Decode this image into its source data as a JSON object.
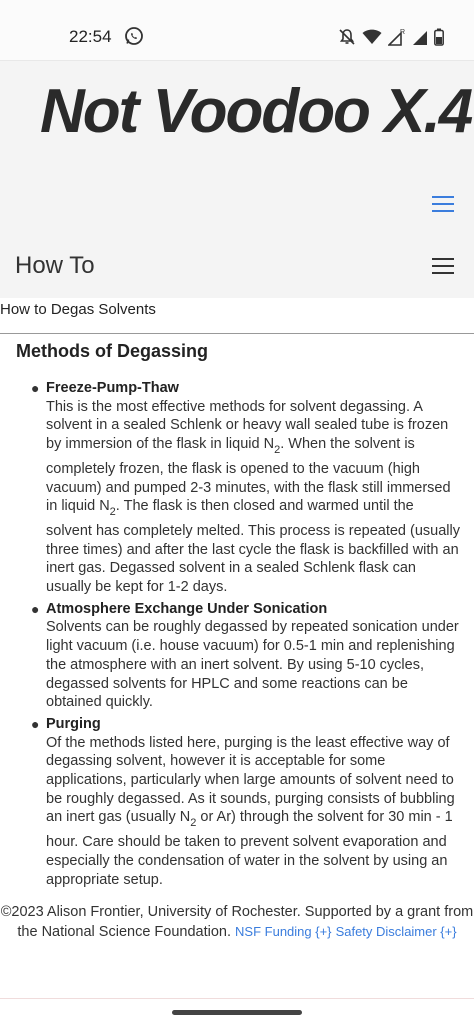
{
  "status_bar": {
    "time": "22:54",
    "icons": [
      "whatsapp-icon",
      "do-not-disturb-icon",
      "wifi-icon",
      "signal-r-icon",
      "signal-icon",
      "battery-icon"
    ],
    "roaming_mark": "R"
  },
  "header": {
    "logo": "Not Voodoo X.4",
    "section_title": "How To"
  },
  "breadcrumb": "How to Degas Solvents",
  "main": {
    "heading": "Methods of Degassing",
    "items": [
      {
        "title": "Freeze-Pump-Thaw",
        "text_1": "This is the most effective methods for solvent degassing. A solvent in a sealed Schlenk or heavy wall sealed tube is frozen by immersion of the flask in liquid N",
        "sub_1": "2",
        "text_2": ". When the solvent is completely frozen, the flask is opened to the vacuum (high vacuum) and pumped 2-3 minutes, with the flask still immersed in liquid N",
        "sub_2": "2",
        "text_3": ". The flask is then closed and warmed until the solvent has completely melted. This process is repeated (usually three times) and after the last cycle the flask is backfilled with an inert gas. Degassed solvent in a sealed Schlenk flask can usually be kept for 1-2 days."
      },
      {
        "title": "Atmosphere Exchange Under Sonication",
        "text_1": "Solvents can be roughly degassed by repeated sonication under light vacuum (i.e. house vacuum) for 0.5-1 min and replenishing the atmosphere with an inert solvent. By using 5-10 cycles, degassed solvents for HPLC and some reactions can be obtained quickly."
      },
      {
        "title": "Purging",
        "text_1": "Of the methods listed here, purging is the least effective way of degassing solvent, however it is acceptable for some applications, particularly when large amounts of solvent need to be roughly degassed. As it sounds, purging consists of bubbling an inert gas (usually N",
        "sub_1": "2",
        "text_2": " or Ar) through the solvent for 30 min - 1 hour. Care should be taken to prevent solvent evaporation and especially the condensation of water in the solvent by using an appropriate setup."
      }
    ]
  },
  "footer": {
    "text": "©2023 Alison Frontier, University of Rochester. Supported by a grant from the National Science Foundation.",
    "link_nsf": "NSF Funding {+}",
    "link_safety": "Safety Disclaimer {+}"
  },
  "colors": {
    "accent": "#3b7ddd",
    "header_bg": "#f4f4f4"
  }
}
